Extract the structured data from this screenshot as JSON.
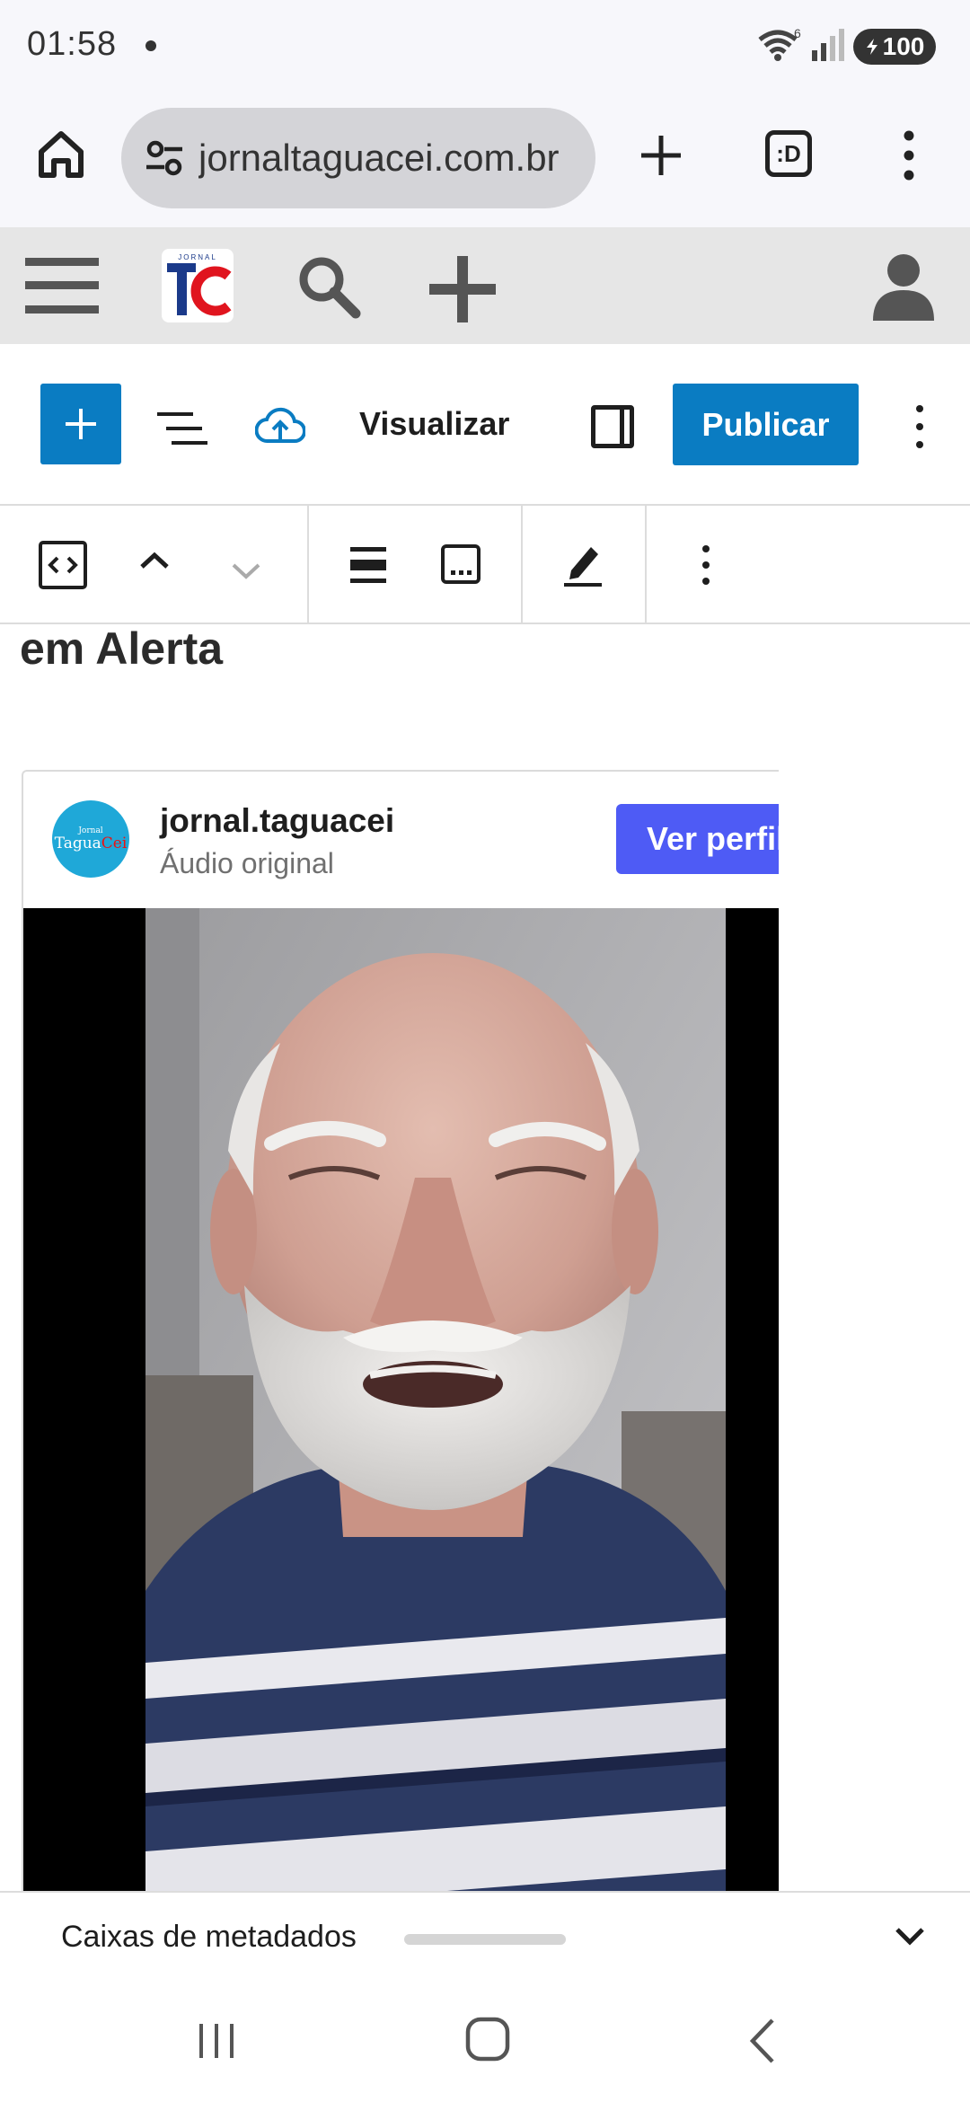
{
  "status_bar": {
    "time": "01:58",
    "wifi_badge": "6",
    "battery": "100"
  },
  "browser": {
    "url": "jornaltaguacei.com.br",
    "tabs_label": ":D"
  },
  "wp_admin_bar": {
    "logo_top": "JORNAL",
    "logo_letters": "TC"
  },
  "editor_toolbar": {
    "preview_label": "Visualizar",
    "publish_label": "Publicar"
  },
  "content": {
    "heading_fragment": "em Alerta",
    "embed": {
      "username": "jornal.taguacei",
      "subtitle": "Áudio original",
      "view_profile_label": "Ver perfil",
      "avatar_small": "Jornal",
      "avatar_main_a": "Tagua",
      "avatar_main_b": "Cei"
    }
  },
  "metadata": {
    "label": "Caixas de metadados"
  },
  "colors": {
    "wp_blue": "#0a7cc2",
    "instagram_button": "#4e5bf5",
    "admin_bar": "#e6e6e6"
  }
}
